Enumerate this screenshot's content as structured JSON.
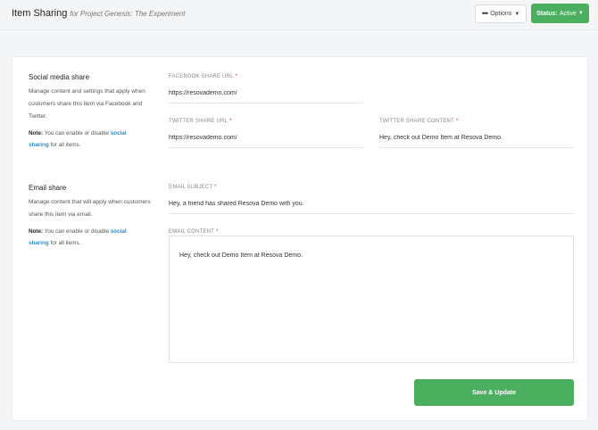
{
  "header": {
    "title": "Item Sharing",
    "subtitle": "for Project Genesis: The Experiment",
    "options_label": "Options",
    "status_prefix": "Status:",
    "status_value": "Active"
  },
  "social": {
    "title": "Social media share",
    "description": "Manage content and settings that apply when customers share this item via Facebook and Twitter.",
    "note_label": "Note:",
    "note_text": " You can enable or disable ",
    "note_link": "social sharing",
    "note_suffix": " for all items.",
    "facebook_url_label": "FACEBOOK SHARE URL",
    "facebook_url_value": "https://resovademo.com/",
    "twitter_url_label": "TWITTER SHARE URL",
    "twitter_url_value": "https://resovademo.com/",
    "twitter_content_label": "TWITTER SHARE CONTENT",
    "twitter_content_value": "Hey, check out Demo Item at Resova Demo."
  },
  "email": {
    "title": "Email share",
    "description": "Manage content that will apply when customers share this item via email.",
    "note_label": "Note:",
    "note_text": " You can enable or disable ",
    "note_link": "social sharing",
    "note_suffix": " for all items.",
    "subject_label": "EMAIL SUBJECT",
    "subject_value": "Hey, a friend has shared Resova Demo with you.",
    "content_label": "EMAIL CONTENT",
    "content_value": "Hey, check out Demo Item at Resova Demo."
  },
  "required_marker": "*",
  "save_label": "Save & Update",
  "colors": {
    "accent_green": "#4cae5f",
    "link_blue": "#2a8ec9",
    "required_red": "#e0342c"
  },
  "icons": {
    "options": "more-dots-icon",
    "dropdown": "caret-down-icon"
  }
}
